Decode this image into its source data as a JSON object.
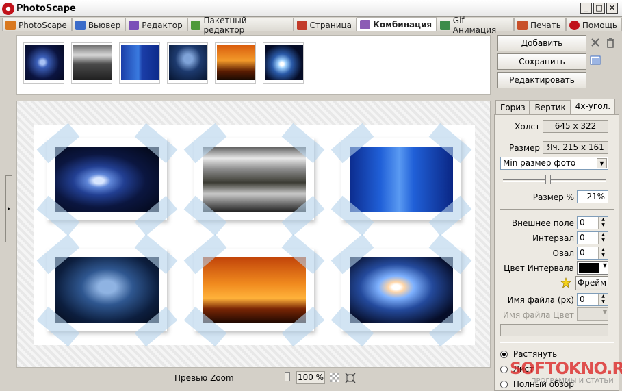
{
  "window": {
    "title": "PhotoScape",
    "buttons": [
      "_",
      "□",
      "✕"
    ]
  },
  "tabs": [
    {
      "label": "PhotoScape",
      "color": "#d9781e"
    },
    {
      "label": "Вьювер",
      "color": "#3a6bc9"
    },
    {
      "label": "Редактор",
      "color": "#7a4fb8"
    },
    {
      "label": "Пакетный редактор",
      "color": "#4f9a3a"
    },
    {
      "label": "Страница",
      "color": "#c23b2a"
    },
    {
      "label": "Комбинация",
      "color": "#8c5bb5",
      "active": true
    },
    {
      "label": "Gif-Анимация",
      "color": "#3c8c4a"
    },
    {
      "label": "Печать",
      "color": "#c8502a"
    },
    {
      "label": "Помощь",
      "color": "#c0121a"
    }
  ],
  "actions": {
    "add": "Добавить",
    "save": "Сохранить",
    "edit": "Редактировать"
  },
  "panel_tabs": [
    {
      "label": "Гориз"
    },
    {
      "label": "Вертик"
    },
    {
      "label": "4х-угол.",
      "active": true
    }
  ],
  "panel": {
    "canvas_label": "Холст",
    "canvas_value": "645 x 322",
    "size_label": "Размер",
    "size_value": "Яч. 215 x 161",
    "size_mode": "Min размер фото",
    "size_pct_label": "Размер %",
    "size_pct_value": "21%",
    "outer_margin_label": "Внешнее поле",
    "outer_margin_value": "0",
    "interval_label": "Интервал",
    "interval_value": "0",
    "oval_label": "Овал",
    "oval_value": "0",
    "interval_color_label": "Цвет Интервала",
    "interval_color": "#000000",
    "frame_button": "Фрейм",
    "filename_label": "Имя файла (px)",
    "filename_value": "0",
    "filename_color_label": "Имя файла Цвет",
    "radio_stretch": "Растянуть",
    "radio_sheet": "Лист",
    "radio_full": "Полный обзор"
  },
  "bottom": {
    "zoom_label": "Превью Zoom",
    "zoom_value": "100 %"
  },
  "watermark": {
    "brand": "SOFTOKNO.RU",
    "tagline": "ПРОГРАММЫ И СТАТЬИ"
  }
}
